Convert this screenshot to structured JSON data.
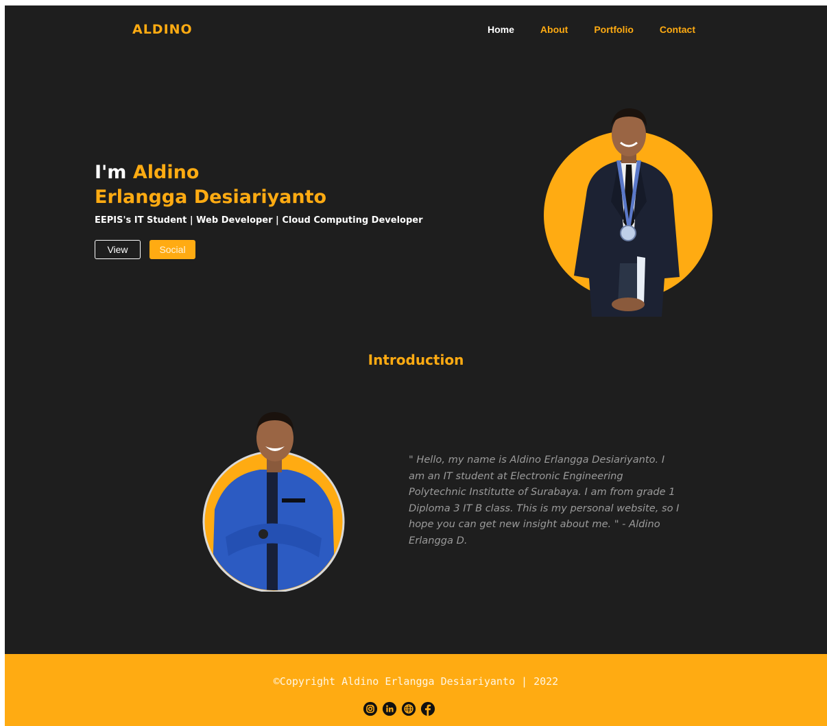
{
  "brand": {
    "logo": "ALDINO"
  },
  "nav": {
    "items": [
      {
        "label": "Home",
        "active": true
      },
      {
        "label": "About"
      },
      {
        "label": "Portfolio"
      },
      {
        "label": "Contact"
      }
    ]
  },
  "hero": {
    "greeting": "I'm",
    "name_line1": "Aldino",
    "name_line2": "Erlangga Desiariyanto",
    "subtitle": "EEPIS's IT Student | Web Developer | Cloud Computing Developer",
    "view_label": "View",
    "social_label": "Social"
  },
  "intro": {
    "title": "Introduction",
    "quote": "\" Hello, my name is Aldino Erlangga Desiariyanto. I am an IT student at Electronic Engineering Polytechnic Institutte of Surabaya. I am from grade 1 Diploma 3 IT B class. This is my personal website, so I hope you can get new insight about me. \" - Aldino Erlangga D."
  },
  "footer": {
    "copyright": "©Copyright Aldino Erlangga Desiariyanto | 2022",
    "socials": [
      "instagram-icon",
      "linkedin-icon",
      "globe-icon",
      "facebook-icon"
    ]
  },
  "colors": {
    "accent": "#ffab12",
    "background": "#1e1e1e",
    "text": "#ffffff"
  }
}
